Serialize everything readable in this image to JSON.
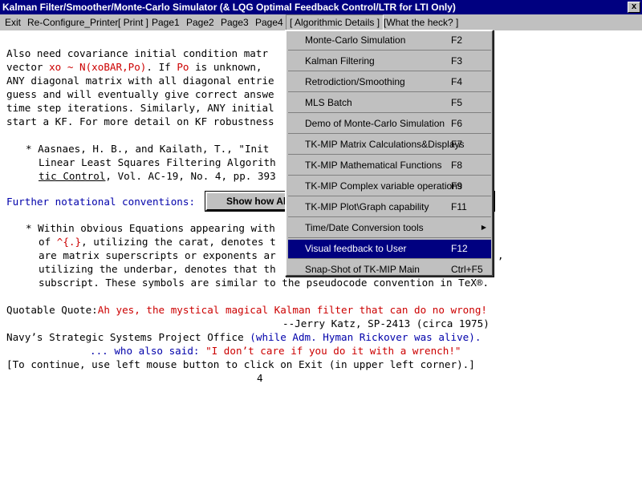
{
  "window": {
    "title": "Kalman Filter/Smoother/Monte-Carlo Simulator (& LQG Optimal Feedback Control/LTR for LTI Only)",
    "close_glyph": "x"
  },
  "menubar": {
    "items": [
      {
        "label": "Exit",
        "mnemonic": "E"
      },
      {
        "label": "Re-Configure_Printer"
      },
      {
        "label": "[ Print ]"
      },
      {
        "label": "Page1"
      },
      {
        "label": "Page2"
      },
      {
        "label": "Page3"
      },
      {
        "label": "Page4"
      },
      {
        "label": "[  Algorithmic Details  ]"
      },
      {
        "label": "[What the heck? ]"
      }
    ]
  },
  "content": {
    "para1": [
      "Also need covariance initial condition matr",
      "ANY diagonal matrix with all diagonal entrie",
      "guess and will eventually give correct answe",
      "time step iterations. Similarly, ANY initial",
      "start a KF. For more detail on KF robustness"
    ],
    "vector_line": {
      "a": "vector ",
      "b": "xo ~ N(xoBAR,Po)",
      "c": ". If ",
      "d": "Po",
      "e": " is unknown, "
    },
    "ref": {
      "line1": "* Aasnaes, H. B., and Kailath, T., \"Init",
      "line2": "Linear Least Squares Filtering Algorith",
      "line3_ul": "tic Control",
      "line3_rest": ", Vol. AC-19, No. 4, pp. 393"
    },
    "further": "Further notational conventions:",
    "show_button": "Show how Al",
    "notes": {
      "l1": "* Within obvious Equations appearing with",
      "l2a": "of ",
      "l2b": "^{.}",
      "l2c": ", utilizing the carat, denotes t",
      "l3": "are matrix superscripts or exponents ar",
      "l3_tail": ",",
      "l4": "utilizing the underbar, denotes that th",
      "l5": "subscript. These symbols are similar to the pseudocode convention in TeX®."
    },
    "quote_label": "Quotable Quote:",
    "quote_text": "Ah yes, the mystical magical Kalman filter that can do no wrong!",
    "quote_author": "--Jerry Katz, SP-2413 (circa 1975)",
    "navy_a": "Navy’s Strategic Systems Project Office ",
    "navy_b": "(while Adm. Hyman Rickover was alive).",
    "also_a": "... who also said: ",
    "also_b": "\"I don’t care if you do it with a wrench!\"",
    "continue": "[To continue, use left mouse button to click on Exit (in upper left corner).]",
    "page_number": "4"
  },
  "dropdown": {
    "items": [
      {
        "label": "Monte-Carlo Simulation",
        "shortcut": "F2"
      },
      {
        "label": "Kalman Filtering",
        "shortcut": "F3"
      },
      {
        "label": "Retrodiction/Smoothing",
        "shortcut": "F4"
      },
      {
        "label": "MLS Batch",
        "shortcut": "F5"
      },
      {
        "label": "Demo of Monte-Carlo Simulation",
        "shortcut": "F6"
      },
      {
        "label": "TK-MIP Matrix Calculations&Displays",
        "shortcut": "F7"
      },
      {
        "label": "TK-MIP Mathematical Functions",
        "shortcut": "F8"
      },
      {
        "label": "TK-MIP Complex variable operations",
        "shortcut": "F9"
      },
      {
        "label": "TK-MIP Plot\\Graph capability",
        "shortcut": "F11"
      },
      {
        "label": "Time/Date Conversion tools",
        "shortcut": "",
        "submenu_icon": "triangle-right"
      },
      {
        "label": "Visual feedback to User",
        "shortcut": "F12",
        "selected": true
      },
      {
        "label": "Snap-Shot of TK-MIP Main",
        "shortcut": "Ctrl+F5"
      }
    ]
  }
}
